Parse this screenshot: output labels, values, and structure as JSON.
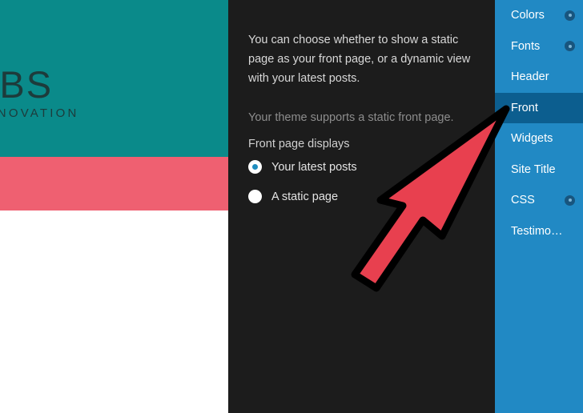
{
  "preview": {
    "site_title": "ABS",
    "tagline": "D INNOVATION",
    "header_color": "#0a8a8a",
    "band_color": "#ef6071",
    "body_color": "#ffffff"
  },
  "panel": {
    "description": "You can choose whether to show a static page as your front page, or a dynamic view with your latest posts.",
    "theme_note": "Your theme supports a static front page.",
    "group_label": "Front page displays",
    "background_color": "#1c1c1c",
    "options": [
      {
        "label": "Your latest posts",
        "selected": true
      },
      {
        "label": "A static page",
        "selected": false
      }
    ]
  },
  "sidebar": {
    "background_color": "#2189c4",
    "active_color": "#0c5e8f",
    "items": [
      {
        "label": "Colors",
        "icon": "circle-dot-icon",
        "has_icon": true,
        "active": false
      },
      {
        "label": "Fonts",
        "icon": "circle-dot-icon",
        "has_icon": true,
        "active": false
      },
      {
        "label": "Header",
        "icon": "",
        "has_icon": false,
        "active": false
      },
      {
        "label": "Front",
        "icon": "",
        "has_icon": false,
        "active": true
      },
      {
        "label": "Widgets",
        "icon": "",
        "has_icon": false,
        "active": false
      },
      {
        "label": "Site Title",
        "icon": "",
        "has_icon": false,
        "active": false
      },
      {
        "label": "CSS",
        "icon": "circle-dot-icon",
        "has_icon": true,
        "active": false
      },
      {
        "label": "Testimo…",
        "icon": "",
        "has_icon": false,
        "active": false
      }
    ]
  },
  "annotation": {
    "arrow_fill": "#e8404f",
    "arrow_outline": "#000000",
    "points_to": "Front"
  }
}
